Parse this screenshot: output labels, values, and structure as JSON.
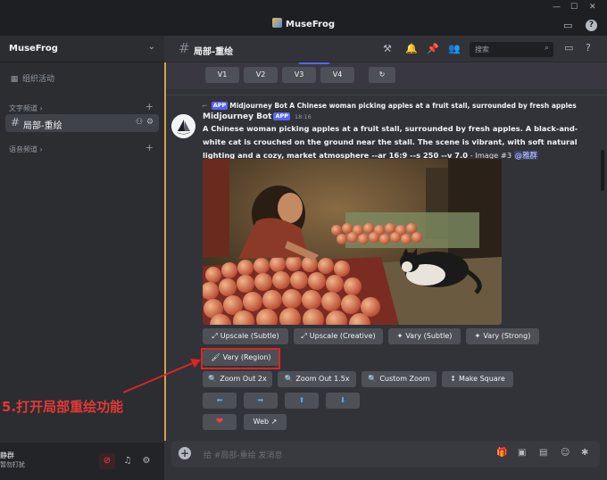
{
  "window": {
    "title": "MuseFrog",
    "controls": [
      "—",
      "☐",
      "✕"
    ]
  },
  "sidebar": {
    "server_name": "MuseFrog",
    "activity": "组织活动",
    "text_category": "文字频道",
    "active_channel": "局部-重绘",
    "voice_category": "语音频道",
    "user_name": "静群",
    "user_status": "暂勿打扰"
  },
  "header": {
    "channel": "局部-重绘",
    "search_placeholder": "搜索"
  },
  "top_buttons": [
    {
      "label": "V1"
    },
    {
      "label": "V2"
    },
    {
      "label": "V3"
    },
    {
      "label": "V4"
    },
    {
      "label": "↻"
    }
  ],
  "message": {
    "reply_author": "Midjourney Bot",
    "reply_text": "A Chinese woman picking apples at a fruit stall, surrounded by fresh apples. A bla...",
    "app_tag": "APP",
    "author": "Midjourney Bot",
    "time": "18:16",
    "prompt_bold": "A Chinese woman picking apples at a fruit stall, surrounded by fresh apples. A black-and-white cat is crouched on the ground near the stall. The scene is vibrant, with soft natural lighting and a cozy, market atmosphere --ar 16:9 --s 250 --v 7.0",
    "prompt_rest": " - Image #3 ",
    "mention": "@雅群"
  },
  "actions": {
    "row1": [
      "Upscale (Subtle)",
      "Upscale (Creative)",
      "Vary (Subtle)",
      "Vary (Strong)"
    ],
    "row2": [
      "Vary (Region)"
    ],
    "row3": [
      "Zoom Out 2x",
      "Zoom Out 1.5x",
      "Custom Zoom",
      "Make Square"
    ],
    "row4": [
      "⬅",
      "➡",
      "⬆",
      "⬇"
    ],
    "row5": [
      "❤",
      "Web"
    ]
  },
  "annotation": {
    "text": "5.打开局部重绘功能"
  },
  "composer": {
    "placeholder": "给 #局部-重绘 发消息"
  },
  "colors": {
    "accent": "#5865f2",
    "annotation_red": "#e02424",
    "highlight_gold": "#d2a24c"
  }
}
